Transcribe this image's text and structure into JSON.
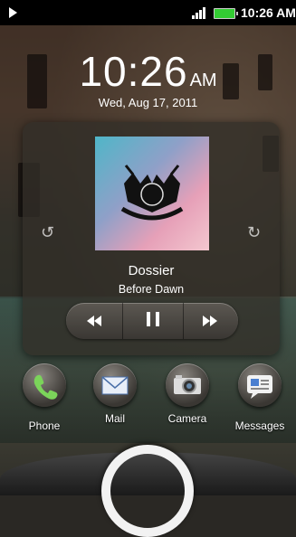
{
  "status_bar": {
    "time": "10:26 AM"
  },
  "lockscreen": {
    "clock": {
      "time": "10:26",
      "ampm": "AM",
      "date": "Wed, Aug 17, 2011"
    }
  },
  "music_widget": {
    "track_title": "Dossier",
    "album": "Before Dawn",
    "icons": [
      "prev-arrow-icon",
      "next-arrow-icon",
      "rewind-icon",
      "pause-icon",
      "forward-icon"
    ]
  },
  "apps": [
    {
      "label": "Phone",
      "icon": "phone-icon"
    },
    {
      "label": "Mail",
      "icon": "mail-icon"
    },
    {
      "label": "Camera",
      "icon": "camera-icon"
    },
    {
      "label": "Messages",
      "icon": "messages-icon"
    }
  ],
  "colors": {
    "battery": "#33cc33",
    "widget_bg": "#322e28"
  }
}
